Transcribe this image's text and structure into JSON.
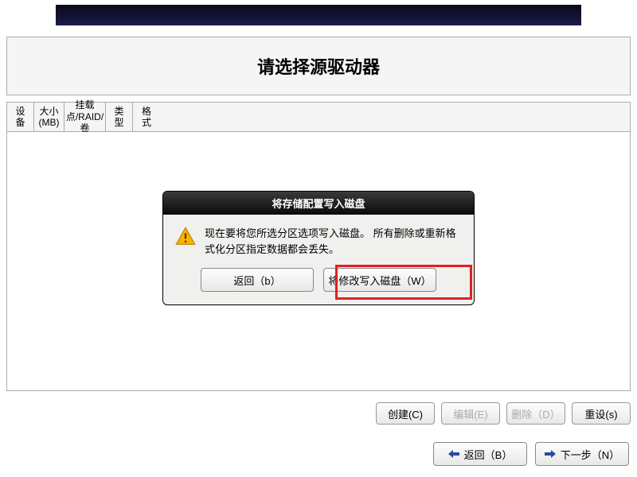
{
  "title": "请选择源驱动器",
  "columns": {
    "device": "设备",
    "size": "大小(MB)",
    "mount": "挂载点/RAID/卷",
    "type": "类型",
    "format": "格式"
  },
  "dialog": {
    "title": "将存储配置写入磁盘",
    "message": "现在要将您所选分区选项写入磁盘。 所有删除或重新格式化分区指定数据都会丢失。",
    "back_label": "返回（b）",
    "write_label": "将修改写入磁盘（W）"
  },
  "actions": {
    "create": "创建(C)",
    "edit": "编辑(E)",
    "delete": "删除（D）",
    "reset": "重设(s)"
  },
  "nav": {
    "back": "返回（B）",
    "next": "下一步（N）"
  }
}
